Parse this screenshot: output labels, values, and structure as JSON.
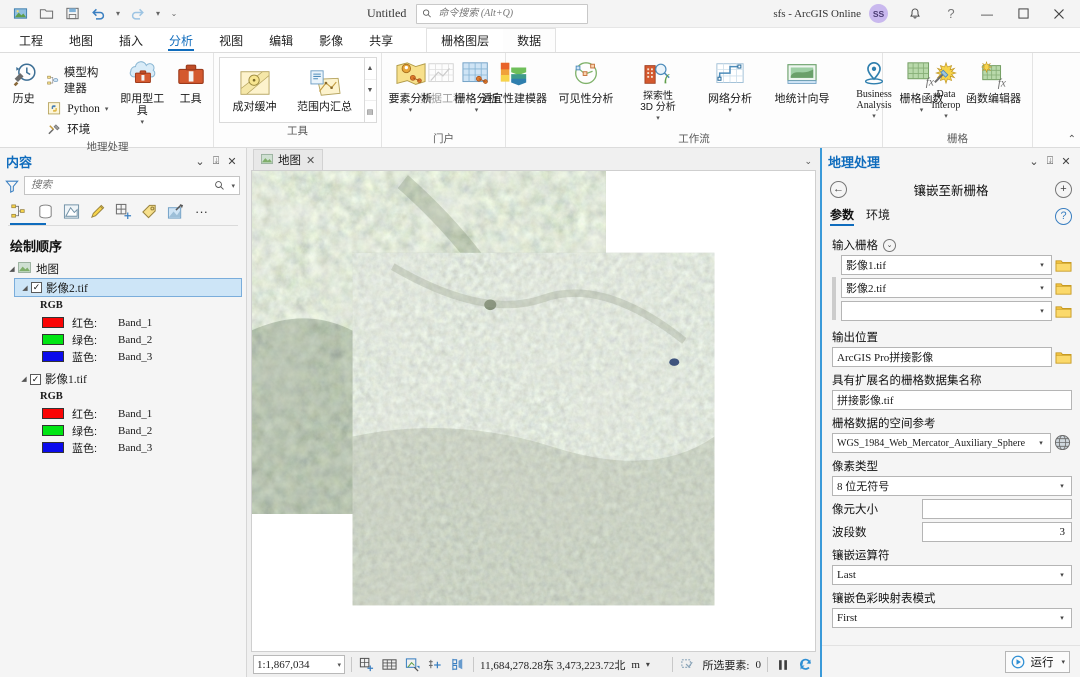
{
  "titlebar": {
    "doc_title": "Untitled",
    "search_placeholder": "命令搜索 (Alt+Q)",
    "account": "sfs - ArcGIS Online",
    "avatar_initials": "SS",
    "qat": [
      "new-project-icon",
      "open-project-icon",
      "save-project-icon",
      "undo-icon",
      "redo-icon",
      "customize-qat-icon"
    ],
    "window_buttons": {
      "minimize": "—",
      "maximize": "▢",
      "close": "✕"
    }
  },
  "ribbon": {
    "tabs": [
      {
        "label": "工程",
        "active": false
      },
      {
        "label": "地图",
        "active": false
      },
      {
        "label": "插入",
        "active": false
      },
      {
        "label": "分析",
        "active": true
      },
      {
        "label": "视图",
        "active": false
      },
      {
        "label": "编辑",
        "active": false
      },
      {
        "label": "影像",
        "active": false
      },
      {
        "label": "共享",
        "active": false
      }
    ],
    "contextual_tabs": [
      {
        "label": "栅格图层",
        "active": true
      },
      {
        "label": "数据",
        "active": false
      }
    ],
    "groups": [
      {
        "label": "地理处理",
        "big": [
          {
            "label": "历史",
            "icon": "history-clock-icon"
          }
        ],
        "small": [
          {
            "label": "模型构建器",
            "icon": "model-builder-icon"
          },
          {
            "label": "Python",
            "icon": "python-icon",
            "caret": true
          },
          {
            "label": "环境",
            "icon": "environments-icon"
          }
        ],
        "big2": [
          {
            "label": "即用型工具",
            "icon": "ready-to-use-tools-icon",
            "caret": true
          },
          {
            "label": "工具",
            "icon": "toolbox-icon"
          }
        ]
      },
      {
        "label": "工具",
        "gallery": [
          {
            "label": "成对缓冲",
            "icon": "pairwise-buffer-icon"
          },
          {
            "label": "范围内汇总",
            "icon": "summarize-within-icon"
          }
        ]
      },
      {
        "label": "门户",
        "big": [
          {
            "label": "要素分析",
            "icon": "feature-analysis-icon",
            "caret": true
          },
          {
            "label": "栅格分析",
            "icon": "raster-analysis-icon",
            "caret": true
          }
        ]
      },
      {
        "label": "工作流",
        "big": [
          {
            "label": "数据工程",
            "icon": "data-engineering-icon",
            "disabled": true
          },
          {
            "label": "适宜性建模器",
            "icon": "suitability-modeler-icon"
          },
          {
            "label": "可见性分析",
            "icon": "visibility-analysis-icon"
          },
          {
            "label": "探索性\n3D 分析",
            "icon": "exploratory-3d-analysis-icon",
            "caret": true
          },
          {
            "label": "网络分析",
            "icon": "network-analysis-icon",
            "caret": true
          },
          {
            "label": "地统计向导",
            "icon": "geostatistical-wizard-icon"
          },
          {
            "label": "Business\nAnalysis",
            "icon": "business-analysis-icon",
            "caret": true
          },
          {
            "label": "Data\nInterop",
            "icon": "data-interop-icon",
            "caret": true
          }
        ]
      },
      {
        "label": "栅格",
        "big": [
          {
            "label": "栅格函数",
            "icon": "raster-functions-icon",
            "caret": true
          },
          {
            "label": "函数编辑器",
            "icon": "function-editor-icon"
          }
        ]
      }
    ]
  },
  "contents": {
    "title": "内容",
    "search_placeholder": "搜索",
    "heading": "绘制顺序",
    "tools": [
      "list-by-drawing-order-icon",
      "list-by-data-source-icon",
      "list-by-selection-icon",
      "list-by-editing-icon",
      "list-by-snapping-icon",
      "list-by-labeling-icon",
      "list-by-diagram-icon",
      "more-options-icon"
    ],
    "map_node": "地图",
    "layers": [
      {
        "name": "影像2.tif",
        "checked": true,
        "selected": true,
        "renderer": "RGB",
        "bands": [
          {
            "label": "红色:",
            "value": "Band_1",
            "color": "#fa0505"
          },
          {
            "label": "绿色:",
            "value": "Band_2",
            "color": "#00e513"
          },
          {
            "label": "蓝色:",
            "value": "Band_3",
            "color": "#0b0bec"
          }
        ]
      },
      {
        "name": "影像1.tif",
        "checked": true,
        "selected": false,
        "renderer": "RGB",
        "bands": [
          {
            "label": "红色:",
            "value": "Band_1",
            "color": "#fa0505"
          },
          {
            "label": "绿色:",
            "value": "Band_2",
            "color": "#00e513"
          },
          {
            "label": "蓝色:",
            "value": "Band_3",
            "color": "#0b0bec"
          }
        ]
      }
    ]
  },
  "map": {
    "tab_label": "地图",
    "tab_icon": "map-tab-icon",
    "close_icon": "✕",
    "status": {
      "scale": "1:1,867,034",
      "coordinates": "11,684,278.28东  3,473,223.72北",
      "units": "m",
      "selected_label": "所选要素:",
      "selected_count": "0",
      "tool_icons": [
        "select-by-rectangle-icon",
        "attribute-table-icon",
        "measure-icon",
        "add-data-icon",
        "bookmarks-icon"
      ],
      "pause_icon": "pause-drawing-icon",
      "refresh_icon": "refresh-icon"
    }
  },
  "geoprocessing": {
    "title": "地理处理",
    "back_icon": "←",
    "add_icon": "+",
    "tool_title": "镶嵌至新栅格",
    "tabs": [
      {
        "label": "参数",
        "active": true
      },
      {
        "label": "环境",
        "active": false
      }
    ],
    "help_icon": "?",
    "fields": {
      "input_rasters_label": "输入栅格",
      "input_rasters": [
        "影像1.tif",
        "影像2.tif",
        ""
      ],
      "output_location_label": "输出位置",
      "output_location": "ArcGIS Pro拼接影像",
      "dataset_name_label": "具有扩展名的栅格数据集名称",
      "dataset_name": "拼接影像.tif",
      "spatial_ref_label": "栅格数据的空间参考",
      "spatial_ref": "WGS_1984_Web_Mercator_Auxiliary_Sphere",
      "pixel_type_label": "像素类型",
      "pixel_type": "8 位无符号",
      "cellsize_label": "像元大小",
      "cellsize": "",
      "band_count_label": "波段数",
      "band_count": "3",
      "mosaic_operator_label": "镶嵌运算符",
      "mosaic_operator": "Last",
      "colormap_mode_label": "镶嵌色彩映射表模式",
      "colormap_mode": "First"
    },
    "run_label": "运行"
  },
  "colors": {
    "accent": "#0f6cbd",
    "panel_border": "#3a9ad9",
    "selection": "#cde5f7",
    "avatar_bg": "#c9b8ee"
  }
}
